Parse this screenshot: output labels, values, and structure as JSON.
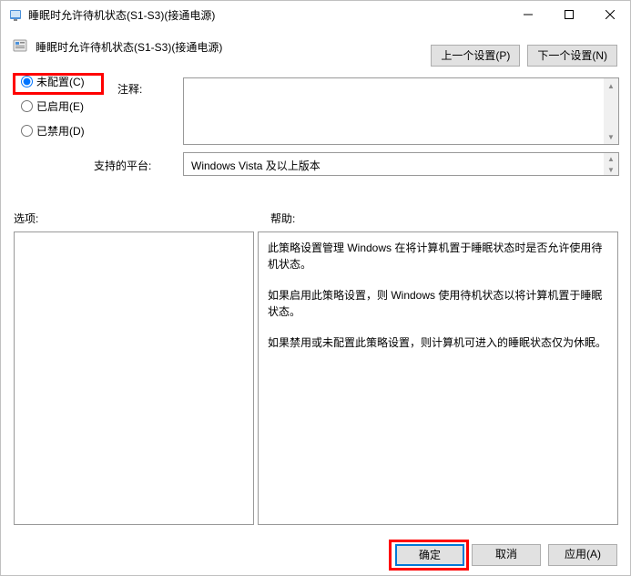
{
  "titlebar": {
    "title": "睡眠时允许待机状态(S1-S3)(接通电源)"
  },
  "header": {
    "policy_name": "睡眠时允许待机状态(S1-S3)(接通电源)",
    "prev_button": "上一个设置(P)",
    "next_button": "下一个设置(N)"
  },
  "radios": {
    "not_configured": "未配置(C)",
    "enabled": "已启用(E)",
    "disabled": "已禁用(D)"
  },
  "labels": {
    "annotation": "注释:",
    "platform": "支持的平台:",
    "options": "选项:",
    "help": "帮助:"
  },
  "platform_text": "Windows Vista 及以上版本",
  "help_text": {
    "p1": "此策略设置管理 Windows 在将计算机置于睡眠状态时是否允许使用待机状态。",
    "p2": "如果启用此策略设置，则 Windows 使用待机状态以将计算机置于睡眠状态。",
    "p3": "如果禁用或未配置此策略设置，则计算机可进入的睡眠状态仅为休眠。"
  },
  "buttons": {
    "ok": "确定",
    "cancel": "取消",
    "apply": "应用(A)"
  }
}
